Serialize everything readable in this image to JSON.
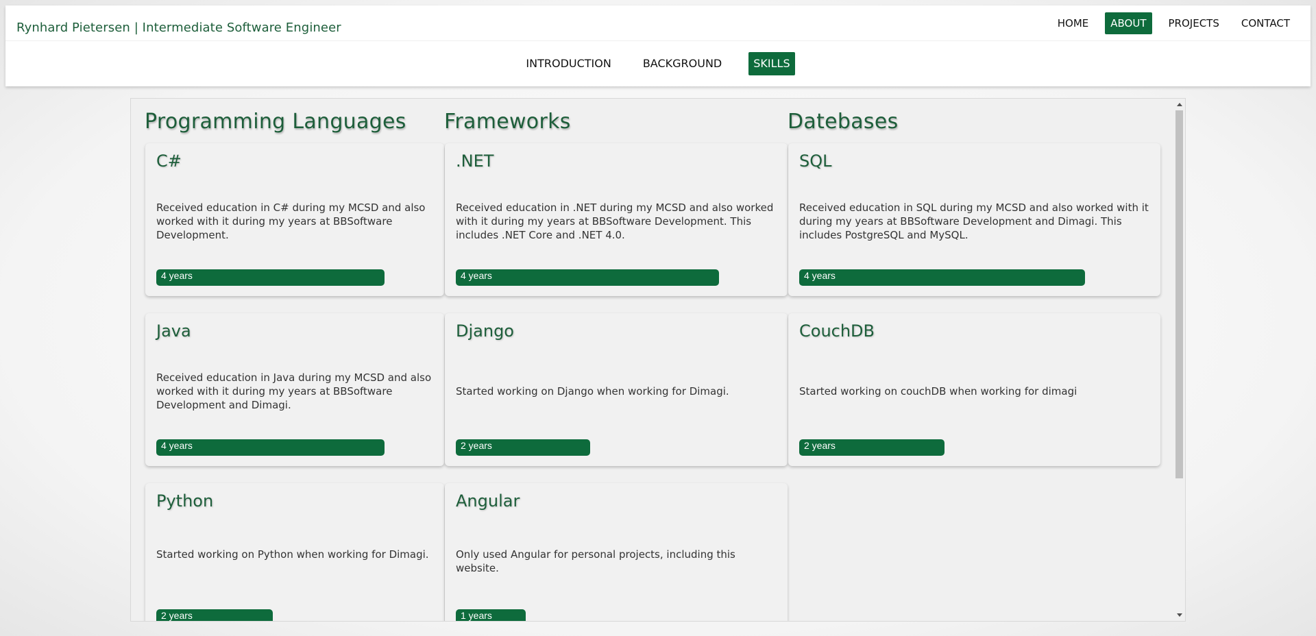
{
  "header": {
    "brand": "Rynhard Pietersen | Intermediate Software Engineer",
    "nav": [
      {
        "label": "HOME",
        "active": false
      },
      {
        "label": "ABOUT",
        "active": true
      },
      {
        "label": "PROJECTS",
        "active": false
      },
      {
        "label": "CONTACT",
        "active": false
      }
    ],
    "subnav": [
      {
        "label": "INTRODUCTION",
        "active": false
      },
      {
        "label": "BACKGROUND",
        "active": false
      },
      {
        "label": "SKILLS",
        "active": true
      }
    ]
  },
  "skills": {
    "columns": [
      {
        "heading": "Programming Languages",
        "cards": [
          {
            "title": "C#",
            "description": "Received education in C# during my MCSD and also worked with it during my years at BBSoftware Development.",
            "duration": "4 years",
            "years": 4
          },
          {
            "title": "Java",
            "description": "Received education in Java during my MCSD and also worked with it during my years at BBSoftware Development and Dimagi.",
            "duration": "4 years",
            "years": 4
          },
          {
            "title": "Python",
            "description": "Started working on Python when working for Dimagi.",
            "duration": "2 years",
            "years": 2
          }
        ]
      },
      {
        "heading": "Frameworks",
        "cards": [
          {
            "title": ".NET",
            "description": "Received education in .NET during my MCSD and also worked with it during my years at BBSoftware Development. This includes .NET Core and .NET 4.0.",
            "duration": "4 years",
            "years": 4
          },
          {
            "title": "Django",
            "description": "Started working on Django when working for Dimagi.",
            "duration": "2 years",
            "years": 2
          },
          {
            "title": "Angular",
            "description": "Only used Angular for personal projects, including this website.",
            "duration": "1 years",
            "years": 1
          }
        ]
      },
      {
        "heading": "Datebases",
        "cards": [
          {
            "title": "SQL",
            "description": "Received education in SQL during my MCSD and also worked with it during my years at BBSoftware Development and Dimagi. This includes PostgreSQL and MySQL.",
            "duration": "4 years",
            "years": 4
          },
          {
            "title": "CouchDB",
            "description": "Started working on couchDB when working for dimagi",
            "duration": "2 years",
            "years": 2
          }
        ]
      }
    ]
  },
  "colors": {
    "accent": "#0e6b3c",
    "heading": "#1d5e3a"
  }
}
